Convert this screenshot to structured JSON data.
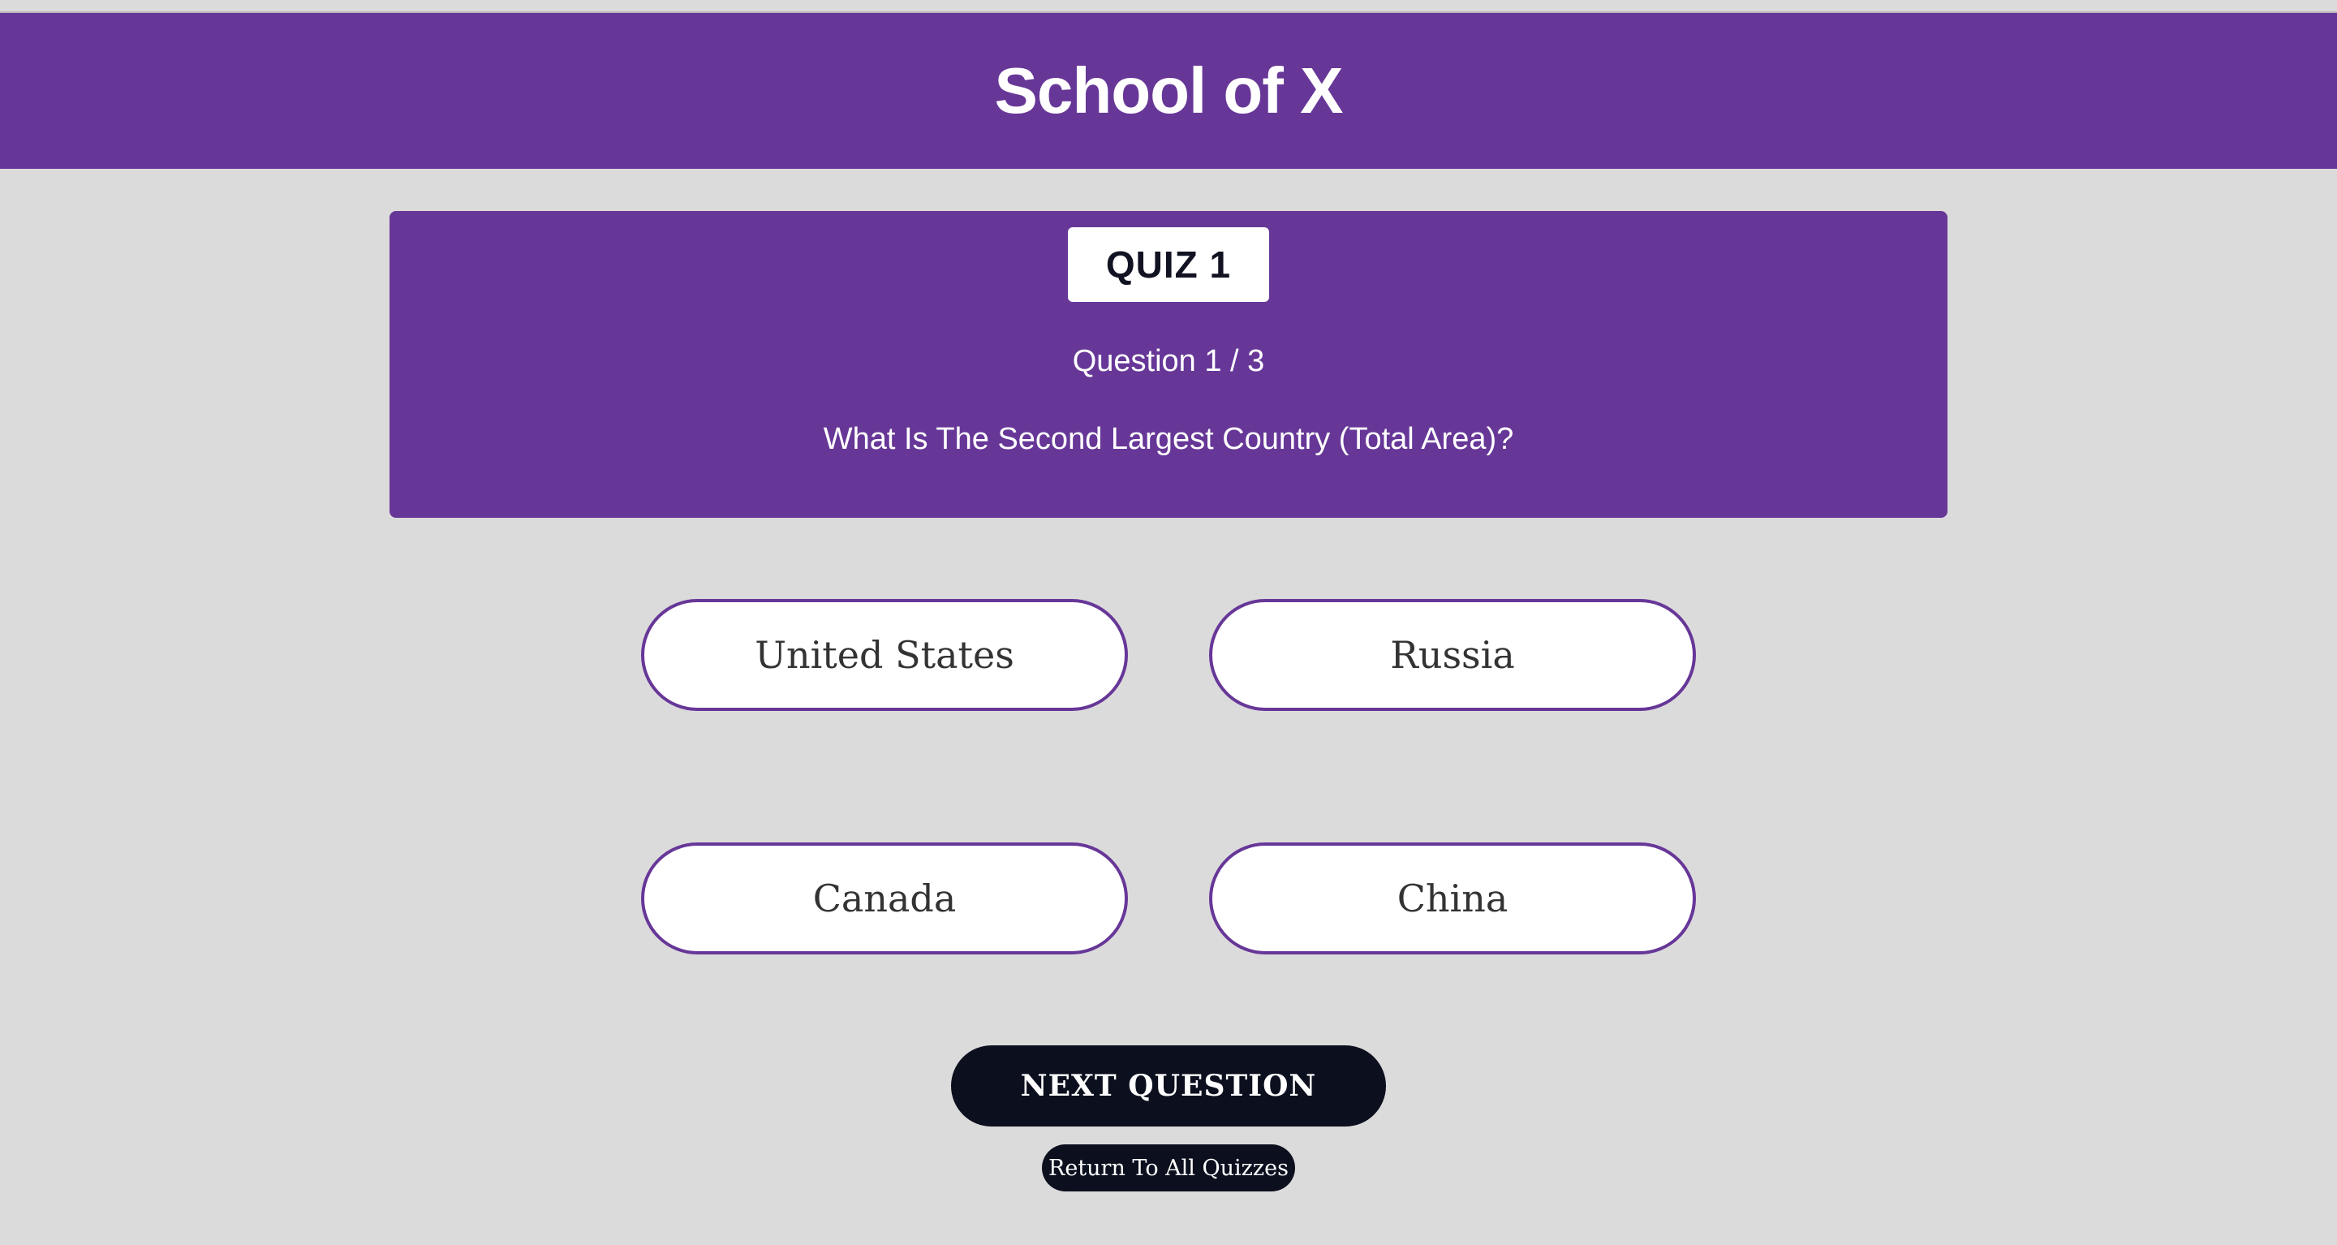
{
  "header": {
    "title": "School of X"
  },
  "quiz": {
    "badge": "QUIZ 1",
    "counter": "Question 1 / 3",
    "question": "What Is The Second Largest Country (Total Area)?"
  },
  "answers": [
    {
      "label": "United States"
    },
    {
      "label": "Russia"
    },
    {
      "label": "Canada"
    },
    {
      "label": "China"
    }
  ],
  "actions": {
    "next_label": "NEXT QUESTION",
    "return_label": "Return To All Quizzes"
  },
  "colors": {
    "brand_purple": "#673798",
    "page_background": "#dcdbdc",
    "dark_button": "#0c0f1e",
    "white": "#ffffff"
  }
}
